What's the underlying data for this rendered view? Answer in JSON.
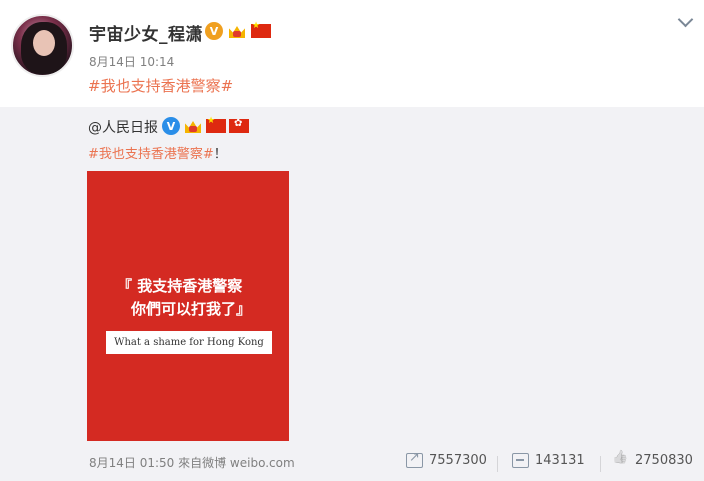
{
  "post": {
    "username": "宇宙少女_程潇",
    "verified_mark": "V",
    "timestamp": "8月14日 10:14",
    "text": "#我也支持香港警察#"
  },
  "repost": {
    "username": "@人民日报",
    "verified_mark": "V",
    "text_tag": "#我也支持香港警察#",
    "text_suffix": "！",
    "poster": {
      "line1": "『 我支持香港警察",
      "line2": "你們可以打我了』",
      "caption": "What a shame for Hong Kong"
    }
  },
  "footer": {
    "meta": "8月14日 01:50 來自微博 weibo.com",
    "reposts": "7557300",
    "comments": "143131",
    "likes": "2750830"
  },
  "colors": {
    "hashtag": "#eb7350",
    "repost_bg": "#f2f2f5",
    "poster_red": "#d42a22"
  }
}
